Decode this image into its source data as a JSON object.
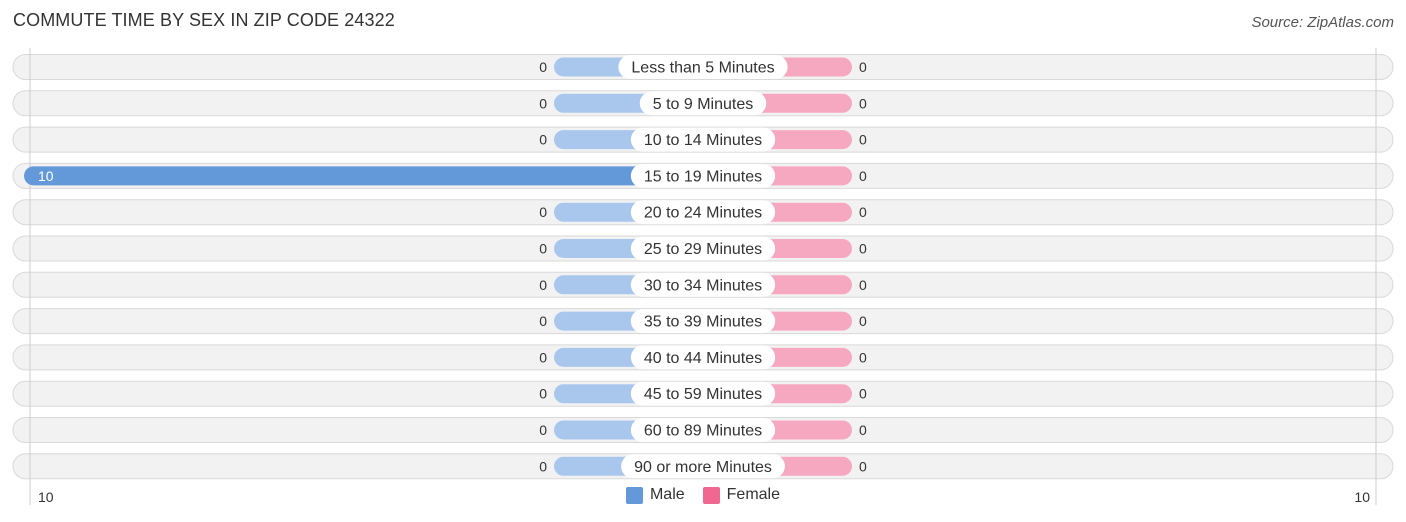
{
  "header": {
    "title": "COMMUTE TIME BY SEX IN ZIP CODE 24322",
    "source": "Source: ZipAtlas.com"
  },
  "colors": {
    "male_strong": "#6399d9",
    "male_light": "#a9c7ec",
    "female_strong": "#f06792",
    "female_light": "#f7a8c1",
    "track": "#f2f2f2",
    "track_border": "#d9d9d9",
    "axis_line": "#cccccc"
  },
  "legend": {
    "male_label": "Male",
    "female_label": "Female"
  },
  "chart_data": {
    "type": "bar",
    "orientation": "horizontal-diverging",
    "title": "COMMUTE TIME BY SEX IN ZIP CODE 24322",
    "categories": [
      "Less than 5 Minutes",
      "5 to 9 Minutes",
      "10 to 14 Minutes",
      "15 to 19 Minutes",
      "20 to 24 Minutes",
      "25 to 29 Minutes",
      "30 to 34 Minutes",
      "35 to 39 Minutes",
      "40 to 44 Minutes",
      "45 to 59 Minutes",
      "60 to 89 Minutes",
      "90 or more Minutes"
    ],
    "series": [
      {
        "name": "Male",
        "side": "left",
        "values": [
          0,
          0,
          0,
          10,
          0,
          0,
          0,
          0,
          0,
          0,
          0,
          0
        ]
      },
      {
        "name": "Female",
        "side": "right",
        "values": [
          0,
          0,
          0,
          0,
          0,
          0,
          0,
          0,
          0,
          0,
          0,
          0
        ]
      }
    ],
    "xlim": [
      -10,
      10
    ],
    "axis_tick_labels": {
      "left": "10",
      "right": "10"
    },
    "legend_position": "bottom-center",
    "grid": false
  }
}
